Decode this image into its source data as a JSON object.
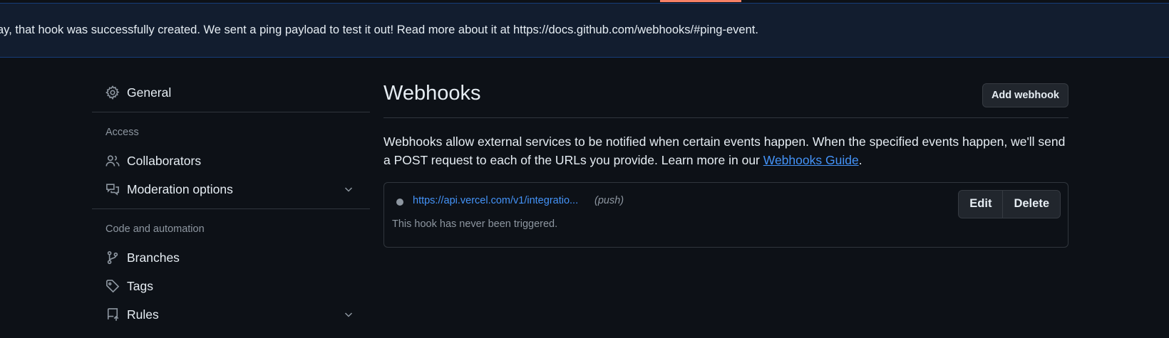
{
  "flash": {
    "message": "ay, that hook was successfully created. We sent a ping payload to test it out! Read more about it at https://docs.github.com/webhooks/#ping-event."
  },
  "sidebar": {
    "general": "General",
    "sections": {
      "access": "Access",
      "code_automation": "Code and automation"
    },
    "items": {
      "collaborators": "Collaborators",
      "moderation": "Moderation options",
      "branches": "Branches",
      "tags": "Tags",
      "rules": "Rules"
    }
  },
  "main": {
    "title": "Webhooks",
    "add_button": "Add webhook",
    "description": "Webhooks allow external services to be notified when certain events happen. When the specified events happen, we'll send a POST request to each of the URLs you provide. Learn more in our ",
    "guide_link": "Webhooks Guide",
    "description_end": ".",
    "hook": {
      "url": "https://api.vercel.com/v1/integratio...",
      "events": "(push)",
      "status": "This hook has never been triggered.",
      "edit": "Edit",
      "delete": "Delete"
    }
  },
  "colors": {
    "background": "#0d1117",
    "flash_bg": "#121d2f",
    "link": "#4493f8",
    "muted": "#8d96a0",
    "accent": "#f78166"
  }
}
